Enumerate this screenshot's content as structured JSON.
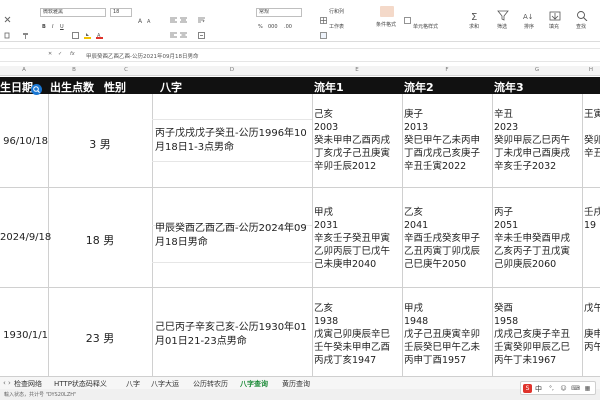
{
  "ribbon": {
    "font_name": "微软雅黑",
    "font_size": "18",
    "number_format": "常规",
    "row_col": "行和列",
    "worksheet": "工作表",
    "cond_format": "条件格式",
    "cell_style": "单元格样式",
    "fill": "填充",
    "sort": "排序",
    "filter": "筛选",
    "freeze": "冻结",
    "find": "查找",
    "sum": "求和"
  },
  "formula_bar": {
    "fx": "fx",
    "content": "甲辰癸酉乙酉乙酉-公历2021年09月18日男命"
  },
  "columns": [
    {
      "letter": "A"
    },
    {
      "letter": "B"
    },
    {
      "letter": "C"
    },
    {
      "letter": "D"
    },
    {
      "letter": "E"
    },
    {
      "letter": "F"
    },
    {
      "letter": "G"
    },
    {
      "letter": "H"
    }
  ],
  "header": {
    "date": "生日期",
    "birth_hour": "出生点数",
    "gender": "性别",
    "bazi": "八字",
    "lu1": "流年1",
    "lu2": "流年2",
    "lu3": "流年3"
  },
  "rows": [
    {
      "date": "96/10/18",
      "hour_gender": "3 男",
      "bazi": "丙子戊戌戊子癸丑-公历1996年10月18日1-3点男命",
      "lu": [
        [
          "己亥",
          "2003",
          "癸未甲申乙酉丙戌",
          "丁亥戊子己丑庚寅",
          "辛卯壬辰2012"
        ],
        [
          "庚子",
          "2013",
          "癸巳甲午乙未丙申",
          "丁酉戊戌己亥庚子",
          "辛丑壬寅2022"
        ],
        [
          "辛丑",
          "2023",
          "癸卯甲辰乙巳丙午",
          "丁未戊申己酉庚戌",
          "辛亥壬子2032"
        ]
      ]
    },
    {
      "date": "2024/9/18",
      "hour_gender": "18 男",
      "bazi": "甲辰癸酉乙酉乙酉-公历2024年09月18日男命",
      "lu": [
        [
          "甲戌",
          "2031",
          "辛亥壬子癸丑甲寅",
          "乙卯丙辰丁巳戊午",
          "己未庚申2040"
        ],
        [
          "乙亥",
          "2041",
          "辛酉壬戌癸亥甲子",
          "乙丑丙寅丁卯戊辰",
          "己巳庚午2050"
        ],
        [
          "丙子",
          "2051",
          "辛未壬申癸酉甲戌",
          "乙亥丙子丁丑戊寅",
          "己卯庚辰2060"
        ]
      ]
    },
    {
      "date": "1930/1/1",
      "hour_gender": "23 男",
      "bazi": "己巳丙子辛亥己亥-公历1930年01月01日21-23点男命",
      "lu": [
        [
          "乙亥",
          "1938",
          "戊寅己卯庚辰辛巳",
          "壬午癸未甲申乙酉",
          "丙戌丁亥1947"
        ],
        [
          "甲戌",
          "1948",
          "戊子己丑庚寅辛卯",
          "壬辰癸巳甲午乙未",
          "丙申丁酉1957"
        ],
        [
          "癸酉",
          "1958",
          "戊戌己亥庚子辛丑",
          "壬寅癸卯甲辰乙巳",
          "丙午丁未1967"
        ]
      ]
    }
  ],
  "col4_partial": [
    "王寅",
    "癸卯",
    "辛丑",
    "壬戌",
    "19",
    "戊午",
    "庚申",
    "丙午"
  ],
  "tabs": [
    {
      "label": "检查网络"
    },
    {
      "label": "HTTP状态码释义"
    },
    {
      "label": "八字"
    },
    {
      "label": "八字大运"
    },
    {
      "label": "公历转农历"
    },
    {
      "label": "八字查询",
      "active": true
    },
    {
      "label": "黄历查询"
    }
  ],
  "status": {
    "left": "輸入状态，共计号 \"DYS20LZH\"",
    "zoom": "100%"
  },
  "ime": {
    "label": "中"
  }
}
